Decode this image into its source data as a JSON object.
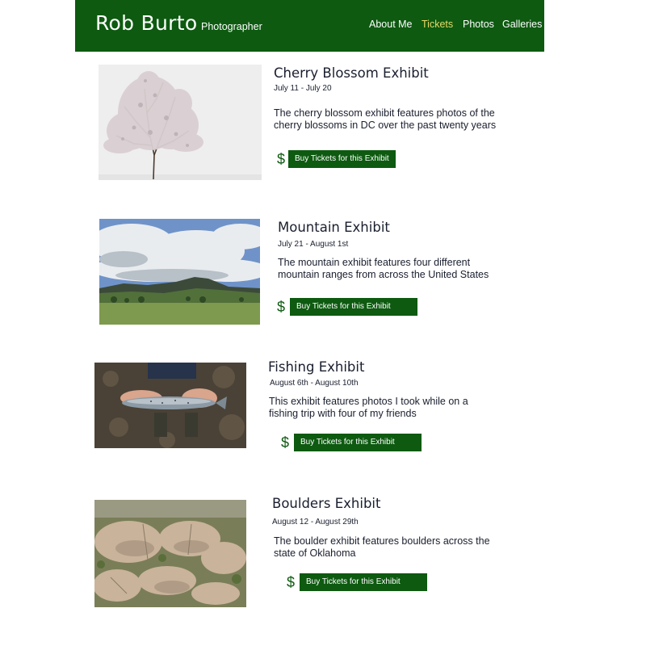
{
  "header": {
    "brand": "Rob Burto",
    "tagline": "Photographer",
    "nav": [
      "About Me",
      "Tickets",
      "Photos",
      "Galleries"
    ],
    "active_nav": "Tickets"
  },
  "colors": {
    "brand_green": "#0d5a10",
    "active_nav": "#e6d96a",
    "text": "#1a1f2e"
  },
  "exhibits": [
    {
      "title": "Cherry Blossom Exhibit",
      "dates": "July 11 - July 20",
      "description": "The cherry blossom exhibit features photos of the cherry blossoms in DC over the past twenty years",
      "currency_symbol": "$",
      "button_label": "Buy Tickets for this Exhibit",
      "photo": "cherry-blossom-tree-photo"
    },
    {
      "title": "Mountain Exhibit",
      "dates": "July 21 - August 1st",
      "description": "The mountain exhibit features four different mountain ranges from across the United States",
      "currency_symbol": "$",
      "button_label": "Buy Tickets for this Exhibit",
      "photo": "mountain-landscape-photo"
    },
    {
      "title": "Fishing Exhibit",
      "dates": "August 6th - August 10th",
      "description": "This exhibit features photos I took while on a fishing trip with four of my friends",
      "currency_symbol": "$",
      "button_label": "Buy Tickets for this Exhibit",
      "photo": "fish-in-hands-photo"
    },
    {
      "title": "Boulders Exhibit",
      "dates": "August 12 - August 29th",
      "description": "The boulder exhibit features boulders across the state of Oklahoma",
      "currency_symbol": "$",
      "button_label": "Buy Tickets for this Exhibit",
      "photo": "boulders-photo"
    }
  ]
}
